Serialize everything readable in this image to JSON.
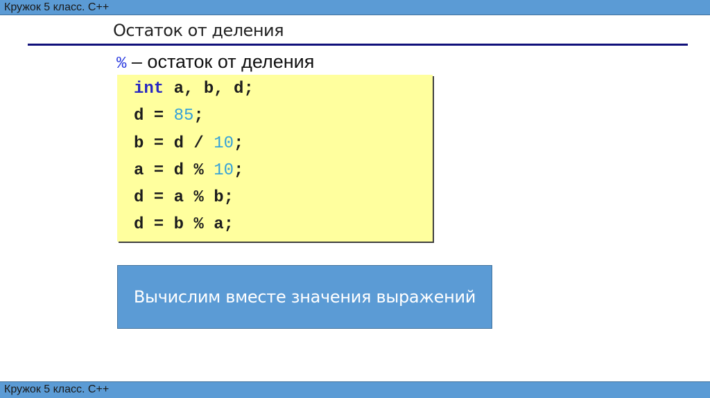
{
  "header": {
    "text": "Кружок 5 класс. С++"
  },
  "slide": {
    "title": "Остаток от деления",
    "subtitle_operator": "%",
    "subtitle_text": " – остаток от деления"
  },
  "code": {
    "lines": [
      [
        {
          "t": "int",
          "c": "kw"
        },
        {
          "t": " a, b, d;",
          "c": ""
        }
      ],
      [
        {
          "t": "d = ",
          "c": ""
        },
        {
          "t": "85",
          "c": "num"
        },
        {
          "t": ";",
          "c": ""
        }
      ],
      [
        {
          "t": "b = d / ",
          "c": ""
        },
        {
          "t": "10",
          "c": "num"
        },
        {
          "t": ";",
          "c": ""
        }
      ],
      [
        {
          "t": "a = d % ",
          "c": ""
        },
        {
          "t": "10",
          "c": "num"
        },
        {
          "t": ";",
          "c": ""
        }
      ],
      [
        {
          "t": "d = a % b;",
          "c": ""
        }
      ],
      [
        {
          "t": "d = b % a;",
          "c": ""
        }
      ]
    ]
  },
  "action_button": {
    "label": "Вычислим вместе значения выражений"
  },
  "footer": {
    "text": "Кружок 5 класс. С++"
  },
  "colors": {
    "bar_blue": "#5b9bd5",
    "code_bg": "#ffff99",
    "keyword": "#1c1cbf",
    "number": "#2b9ed8",
    "rule": "#10107a"
  }
}
